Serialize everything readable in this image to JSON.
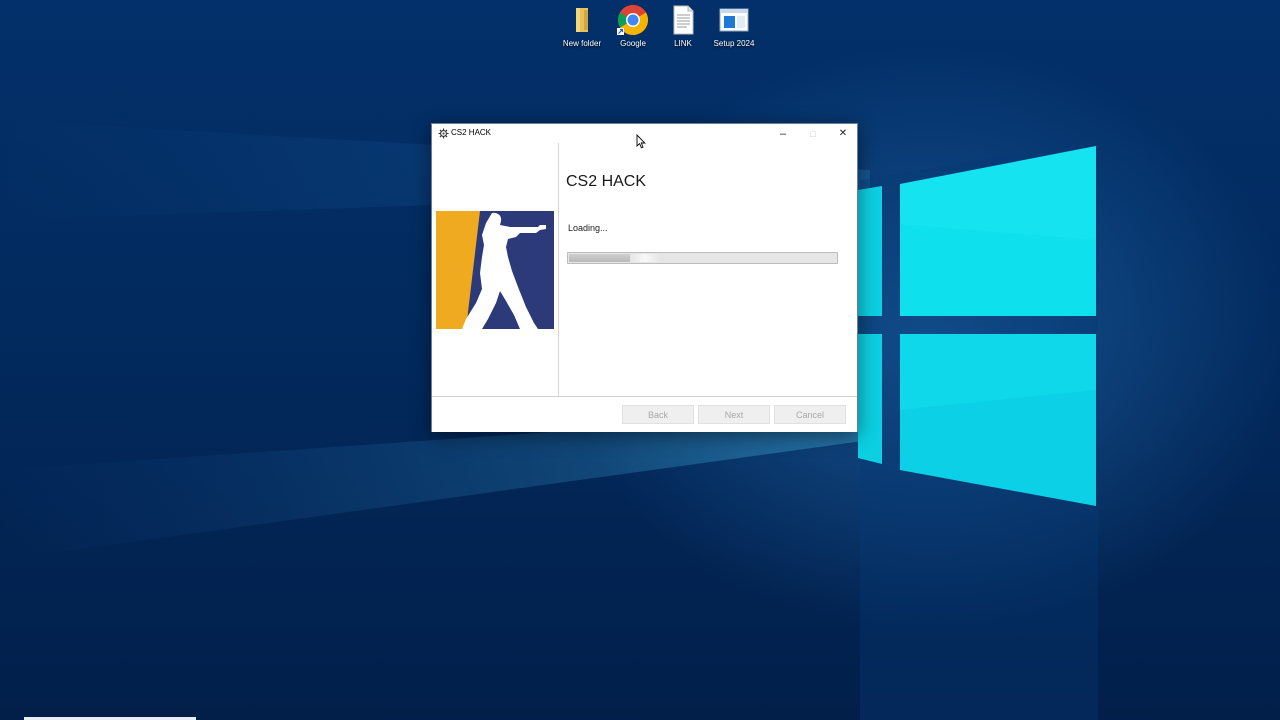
{
  "desktop": {
    "icons": [
      {
        "label": "New folder",
        "icon": "folder-icon"
      },
      {
        "label": "Google",
        "icon": "chrome-icon"
      },
      {
        "label": "LINK",
        "icon": "text-file-icon"
      },
      {
        "label": "Setup 2024",
        "icon": "setup-window-icon"
      }
    ]
  },
  "window": {
    "title": "CS2 HACK",
    "controls": {
      "minimize": "–",
      "maximize": "□",
      "close": "✕"
    },
    "heading": "CS2 HACK",
    "status": "Loading...",
    "progress_percent": 23,
    "buttons": {
      "back": "Back",
      "next": "Next",
      "cancel": "Cancel"
    }
  },
  "colors": {
    "logo_orange": "#f0aa1f",
    "logo_blue": "#2c3a7a",
    "window_border": "#6b7f99"
  }
}
